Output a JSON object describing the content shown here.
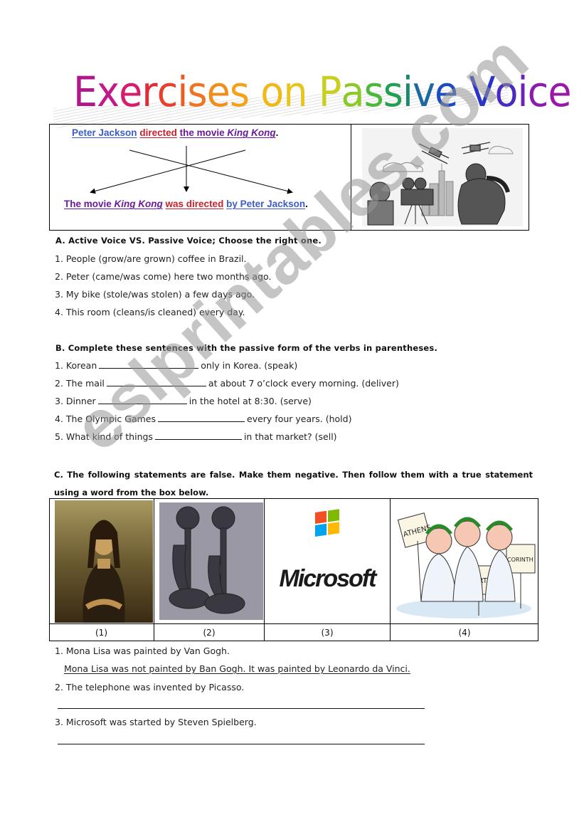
{
  "title": {
    "text": "Exercises on Passive Voice",
    "letters": [
      {
        "ch": "E",
        "color": "#b0178a"
      },
      {
        "ch": "x",
        "color": "#c2188a"
      },
      {
        "ch": "e",
        "color": "#d61c6a"
      },
      {
        "ch": "r",
        "color": "#e02a3a"
      },
      {
        "ch": "c",
        "color": "#e8402a"
      },
      {
        "ch": "i",
        "color": "#ee5a22"
      },
      {
        "ch": "s",
        "color": "#f07420"
      },
      {
        "ch": "e",
        "color": "#f28c1c"
      },
      {
        "ch": "s",
        "color": "#f3a21a"
      },
      {
        "ch": " ",
        "color": "#000000"
      },
      {
        "ch": "o",
        "color": "#f2b818"
      },
      {
        "ch": "n",
        "color": "#e9c41a"
      },
      {
        "ch": " ",
        "color": "#000000"
      },
      {
        "ch": "P",
        "color": "#c8d01e"
      },
      {
        "ch": "a",
        "color": "#8cc828"
      },
      {
        "ch": "s",
        "color": "#4cb83a"
      },
      {
        "ch": "s",
        "color": "#20a050"
      },
      {
        "ch": "i",
        "color": "#188a6a"
      },
      {
        "ch": "v",
        "color": "#1a6aa0"
      },
      {
        "ch": "e",
        "color": "#1c4cc0"
      },
      {
        "ch": " ",
        "color": "#000000"
      },
      {
        "ch": "V",
        "color": "#2a34c8"
      },
      {
        "ch": "o",
        "color": "#4a2ac0"
      },
      {
        "ch": "i",
        "color": "#6a22b8"
      },
      {
        "ch": "c",
        "color": "#8a1cb0"
      },
      {
        "ch": "e",
        "color": "#9a18a8"
      }
    ]
  },
  "example": {
    "active": {
      "subject": "Peter Jackson",
      "verb": "directed",
      "object_prefix": "the movie ",
      "object_title": "King Kong",
      "end": "."
    },
    "passive": {
      "subject_prefix": "The movie ",
      "subject_title": "King Kong",
      "verb": "was directed",
      "agent": "by Peter Jackson",
      "end": "."
    },
    "image_alt": "King Kong cartoon: director with film camera, gorilla, biplanes and city skyline",
    "colors": {
      "agent": "#3c5bc8",
      "verb": "#c8202c",
      "object": "#6a1a9a"
    }
  },
  "section_a": {
    "heading": "A. Active Voice VS. Passive Voice; Choose the right one.",
    "items": [
      "1. People (grow/are grown) coffee in Brazil.",
      "2. Peter (came/was come) here two months ago.",
      "3. My bike (stole/was stolen) a few days ago.",
      "4. This room (cleans/is cleaned) every day."
    ]
  },
  "section_b": {
    "heading": "B. Complete these sentences with the passive form of the verbs in parentheses.",
    "items": [
      {
        "before": "1. Korean",
        "after": "only in Korea. (speak)"
      },
      {
        "before": "2. The mail",
        "after": "at about 7 o’clock every morning. (deliver)"
      },
      {
        "before": "3. Dinner",
        "after": "in the hotel at 8:30. (serve)"
      },
      {
        "before": "4. The Olympic Games",
        "after": "every four years. (hold)"
      },
      {
        "before": "5. What kind of things",
        "after": "in that market? (sell)"
      }
    ]
  },
  "section_c": {
    "heading": "C. The following statements are false. Make them negative. Then follow them with a true statement using a word from the box below.",
    "pictures": [
      {
        "caption": "(1)",
        "alt": "Mona Lisa painting"
      },
      {
        "caption": "(2)",
        "alt": "Antique candlestick telephones"
      },
      {
        "caption": "(3)",
        "alt": "Microsoft logo",
        "logo_text": "Microsoft"
      },
      {
        "caption": "(4)",
        "alt": "Ancient Greeks holding signs",
        "signs": [
          "ATHENS",
          "SPARTA",
          "CORINTH"
        ]
      }
    ],
    "items": [
      {
        "statement": "1. Mona Lisa was painted by Van Gogh.",
        "answer": "Mona Lisa was not painted by Ban Gogh. It was painted by Leonardo da Vinci."
      },
      {
        "statement": "2. The telephone was invented by Picasso.",
        "answer": ""
      },
      {
        "statement": "3. Microsoft was started by Steven Spielberg.",
        "answer": ""
      }
    ]
  },
  "watermark": "eslprintables.com"
}
